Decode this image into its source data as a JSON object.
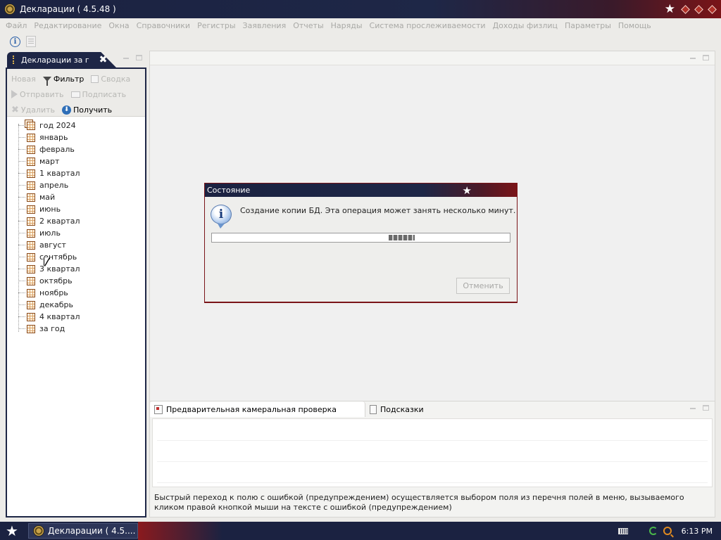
{
  "window": {
    "title": "Декларации ( 4.5.48 )"
  },
  "menu": [
    "Файл",
    "Редактирование",
    "Окна",
    "Справочники",
    "Регистры",
    "Заявления",
    "Отчеты",
    "Наряды",
    "Система прослеживаемости",
    "Доходы физлиц",
    "Параметры",
    "Помощь"
  ],
  "left_panel": {
    "tab_label": "Декларации за г",
    "tools": {
      "new": "Новая",
      "filter": "Фильтр",
      "svodka": "Сводка",
      "send": "Отправить",
      "sign": "Подписать",
      "delete": "Удалить",
      "receive": "Получить"
    },
    "tree": [
      "год 2024",
      "январь",
      "февраль",
      "март",
      "1 квартал",
      "апрель",
      "май",
      "июнь",
      "2 квартал",
      "июль",
      "август",
      "сентябрь",
      "3 квартал",
      "октябрь",
      "ноябрь",
      "декабрь",
      "4 квартал",
      "за год"
    ]
  },
  "bottom_panel": {
    "tabs": [
      "Предварительная камеральная проверка",
      "Подсказки"
    ],
    "hint": "Быстрый переход к полю с ошибкой (предупреждением) осуществляется выбором поля из перечня полей в меню, вызываемого кликом правой кнопкой мыши на тексте с ошибкой (предупреждением)"
  },
  "dialog": {
    "title": "Состояние",
    "message": "Создание копии БД. Эта операция может занять несколько минут.",
    "cancel_label": "Отменить",
    "progress_marquee_position": 0.65
  },
  "taskbar": {
    "task_label": "Декларации ( 4.5....",
    "clock": "6:13 PM"
  },
  "colors": {
    "titlebar": "#1b2241",
    "accent_red": "#7a1418",
    "window_bg": "#ecebe8"
  }
}
